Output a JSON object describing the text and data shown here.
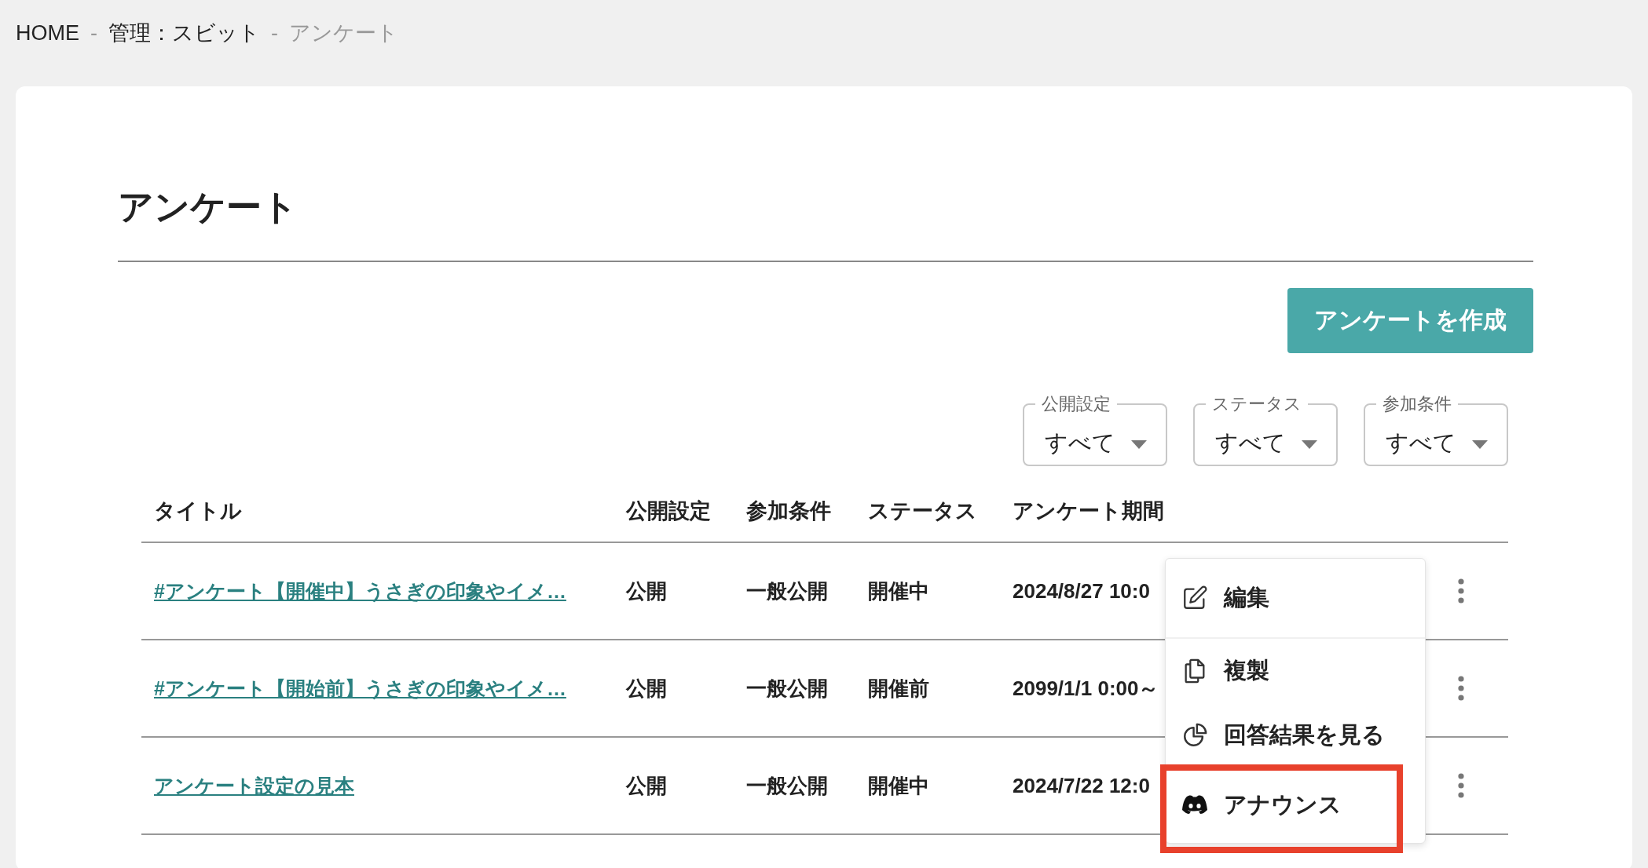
{
  "breadcrumb": [
    {
      "kind": "link",
      "text": "HOME"
    },
    {
      "kind": "separator",
      "text": "-"
    },
    {
      "kind": "link",
      "text": "管理：スビット"
    },
    {
      "kind": "separator",
      "text": "-"
    },
    {
      "kind": "current",
      "text": "アンケート"
    }
  ],
  "page_title": "アンケート",
  "create_button": "アンケートを作成",
  "filters": [
    {
      "label": "公開設定",
      "value": "すべて"
    },
    {
      "label": "ステータス",
      "value": "すべて"
    },
    {
      "label": "参加条件",
      "value": "すべて"
    }
  ],
  "table": {
    "columns": [
      "タイトル",
      "公開設定",
      "参加条件",
      "ステータス",
      "アンケート期間"
    ],
    "rows": [
      {
        "title": "#アンケート【開催中】うさぎの印象やイメ…",
        "visibility": "公開",
        "participation": "一般公開",
        "status": "開催中",
        "period": "2024/8/27 10:0"
      },
      {
        "title": "#アンケート【開始前】うさぎの印象やイメ…",
        "visibility": "公開",
        "participation": "一般公開",
        "status": "開催前",
        "period": "2099/1/1 0:00～"
      },
      {
        "title": "アンケート設定の見本",
        "visibility": "公開",
        "participation": "一般公開",
        "status": "開催中",
        "period": "2024/7/22 12:0"
      }
    ]
  },
  "action_menu": {
    "items": [
      {
        "kind": "edit",
        "label": "編集",
        "highlighted": false
      },
      {
        "kind": "copy",
        "label": "複製",
        "highlighted": false
      },
      {
        "kind": "results",
        "label": "回答結果を見る",
        "highlighted": false
      },
      {
        "kind": "announce",
        "label": "アナウンス",
        "highlighted": true
      }
    ]
  }
}
